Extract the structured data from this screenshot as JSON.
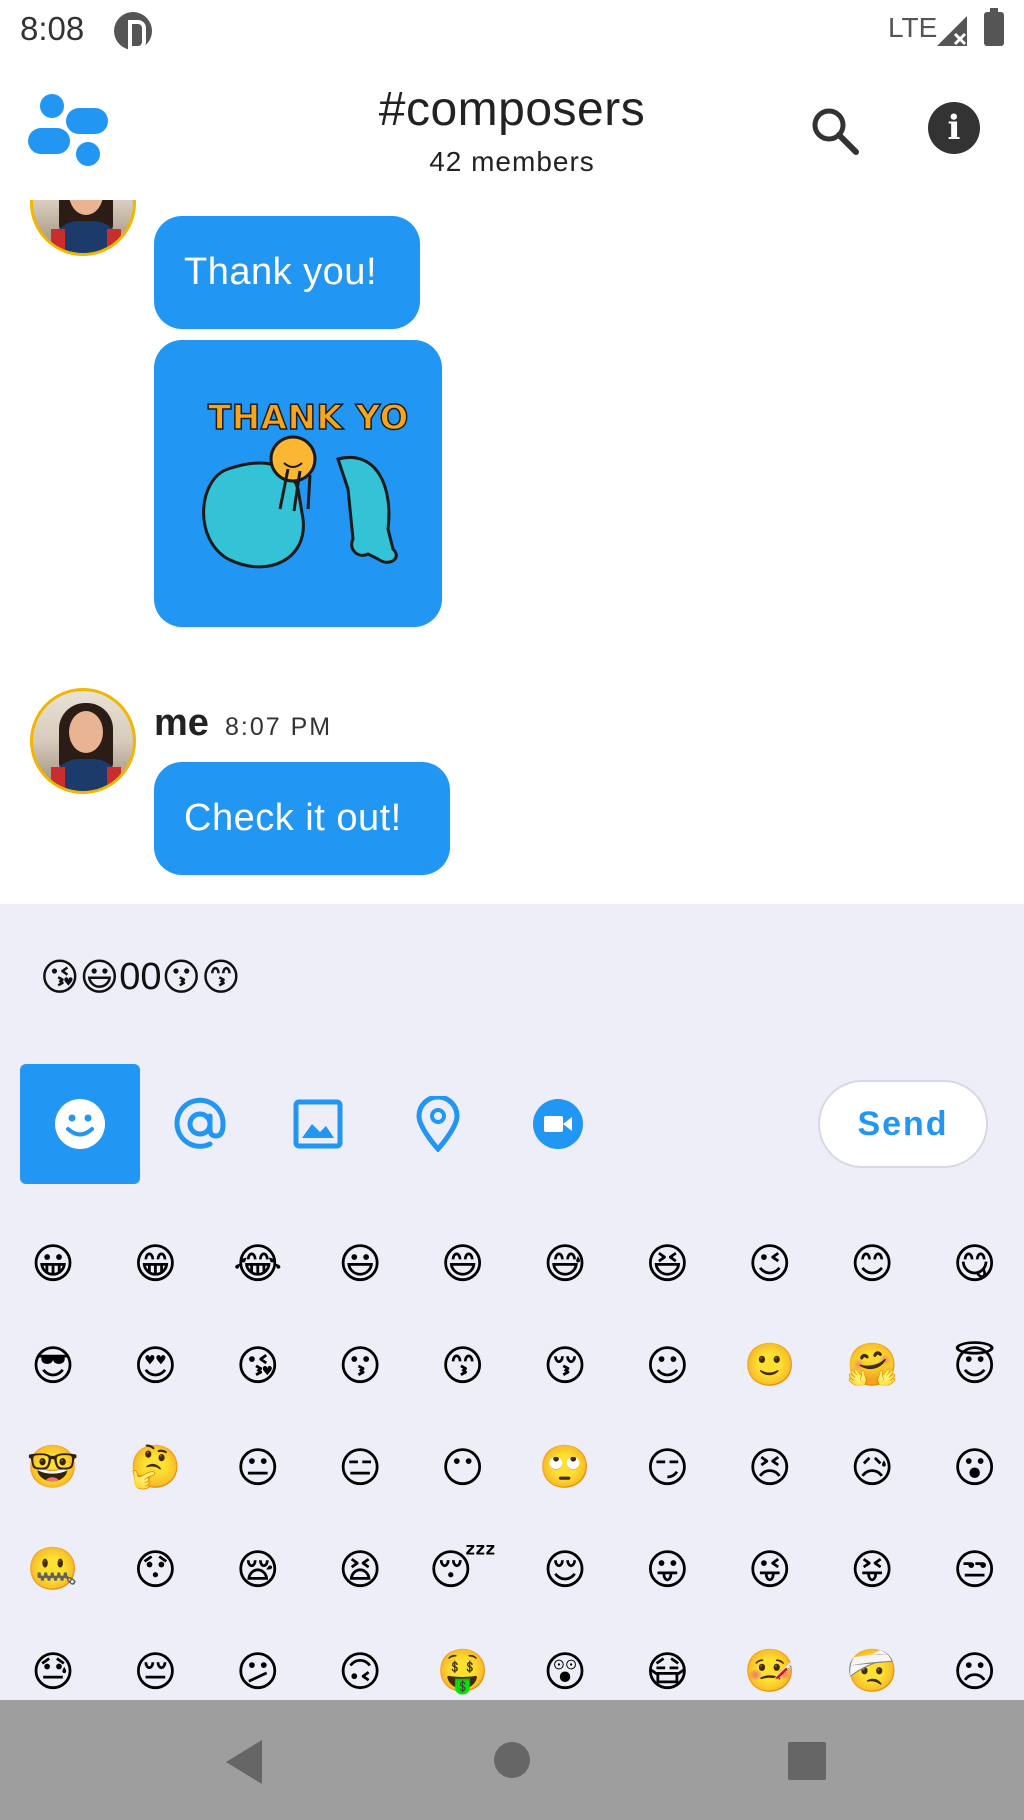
{
  "status_bar": {
    "time": "8:08",
    "network": "LTE"
  },
  "header": {
    "title": "#composers",
    "subtitle": "42 members"
  },
  "messages": [
    {
      "text": "Thank you!"
    },
    {
      "sticker_text": "THANK YOU"
    },
    {
      "sender": "me",
      "time": "8:07 PM",
      "text": "Check it out!"
    }
  ],
  "compose": {
    "input_prefix": "😘😃",
    "input_digits": "00",
    "input_suffix": "😗😙",
    "send_label": "Send",
    "tools": [
      "emoji-icon",
      "mention-icon",
      "image-icon",
      "location-icon",
      "video-icon"
    ]
  },
  "emoji_rows": [
    [
      "😀",
      "😁",
      "😂",
      "😃",
      "😄",
      "😅",
      "😆",
      "😉",
      "😊",
      "😋"
    ],
    [
      "😎",
      "😍",
      "😘",
      "😗",
      "😙",
      "😚",
      "☺",
      "🙂",
      "🤗",
      "😇"
    ],
    [
      "🤓",
      "🤔",
      "😐",
      "😑",
      "😶",
      "🙄",
      "😏",
      "😣",
      "😥",
      "😮"
    ],
    [
      "🤐",
      "😯",
      "😪",
      "😫",
      "😴",
      "😌",
      "😛",
      "😜",
      "😝",
      "😒"
    ],
    [
      "😓",
      "😔",
      "😕",
      "🙃",
      "🤑",
      "😲",
      "😷",
      "🤒",
      "🤕",
      "☹"
    ]
  ],
  "colors": {
    "accent": "#2196F3",
    "compose_bg": "#edeef7",
    "avatar_ring": "#f2b600",
    "nav_bg": "#9e9e9e"
  }
}
